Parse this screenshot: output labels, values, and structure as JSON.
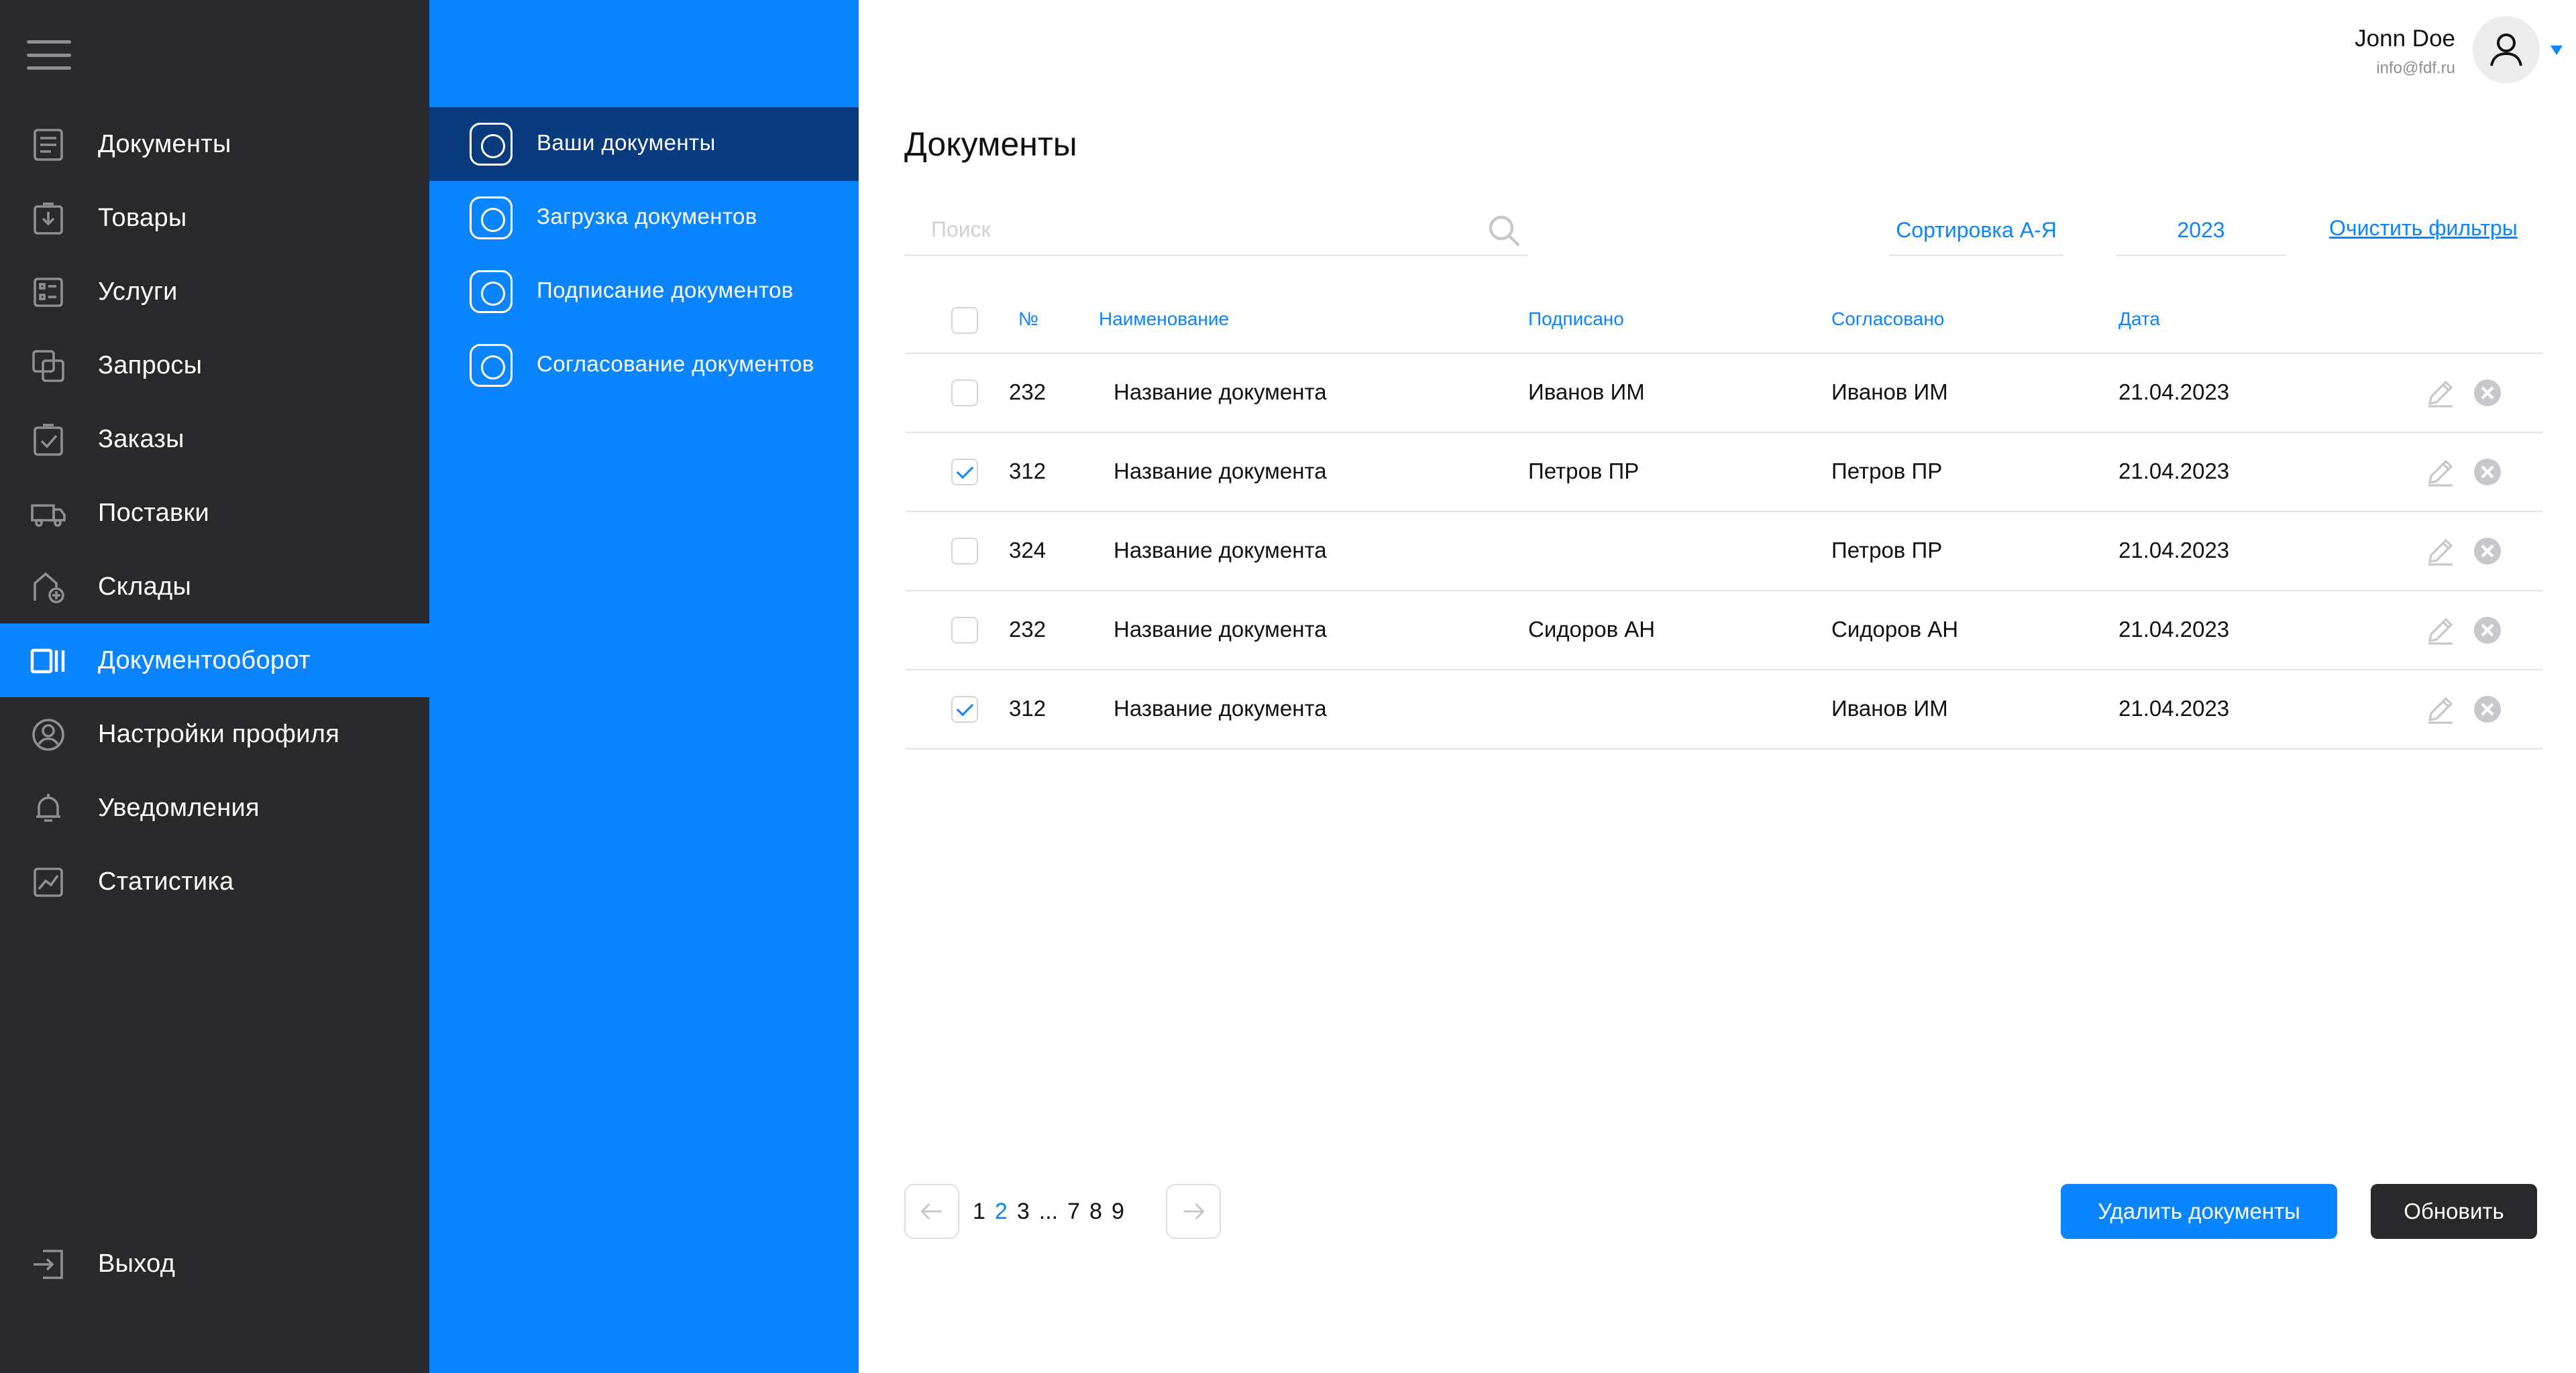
{
  "sidebar": {
    "items": [
      {
        "label": "Документы",
        "icon": "document-icon"
      },
      {
        "label": "Товары",
        "icon": "box-icon"
      },
      {
        "label": "Услуги",
        "icon": "list-icon"
      },
      {
        "label": "Запросы",
        "icon": "copy-icon"
      },
      {
        "label": "Заказы",
        "icon": "checklist-icon"
      },
      {
        "label": "Поставки",
        "icon": "truck-icon"
      },
      {
        "label": "Склады",
        "icon": "warehouse-icon"
      },
      {
        "label": "Документооборот",
        "icon": "workflow-icon",
        "active": true
      },
      {
        "label": "Настройки профиля",
        "icon": "profile-icon"
      },
      {
        "label": "Уведомления",
        "icon": "bell-icon"
      },
      {
        "label": "Статистика",
        "icon": "chart-icon"
      }
    ],
    "logout": {
      "label": "Выход",
      "icon": "logout-icon"
    }
  },
  "subnav": {
    "items": [
      {
        "label": "Ваши документы",
        "active": true
      },
      {
        "label": "Загрузка документов"
      },
      {
        "label": "Подписание документов"
      },
      {
        "label": "Согласование документов"
      }
    ]
  },
  "user": {
    "name": "Jonn Doe",
    "email": "info@fdf.ru"
  },
  "page": {
    "title": "Документы"
  },
  "filters": {
    "search_placeholder": "Поиск",
    "sort_label": "Сортировка А-Я",
    "year_label": "2023",
    "clear_label": "Очистить фильтры"
  },
  "table": {
    "columns": [
      "№",
      "Наименование",
      "Подписано",
      "Согласовано",
      "Дата"
    ],
    "rows": [
      {
        "checked": false,
        "number": "232",
        "name": "Название документа",
        "signed": "Иванов ИМ",
        "approved": "Иванов ИМ",
        "date": "21.04.2023"
      },
      {
        "checked": true,
        "number": "312",
        "name": "Название документа",
        "signed": "Петров ПР",
        "approved": "Петров ПР",
        "date": "21.04.2023"
      },
      {
        "checked": false,
        "number": "324",
        "name": "Название документа",
        "signed": "",
        "approved": "Петров ПР",
        "date": "21.04.2023"
      },
      {
        "checked": false,
        "number": "232",
        "name": "Название документа",
        "signed": "Сидоров АН",
        "approved": "Сидоров АН",
        "date": "21.04.2023"
      },
      {
        "checked": true,
        "number": "312",
        "name": "Название документа",
        "signed": "",
        "approved": "Иванов ИМ",
        "date": "21.04.2023"
      }
    ]
  },
  "pagination": {
    "pages": [
      "1",
      "2",
      "3",
      "...",
      "7",
      "8",
      "9"
    ],
    "current": "2"
  },
  "actions": {
    "delete_label": "Удалить документы",
    "refresh_label": "Обновить"
  },
  "colors": {
    "accent": "#0a84ff",
    "sidebar": "#29292b",
    "subnav_active": "#0a3b7e"
  }
}
